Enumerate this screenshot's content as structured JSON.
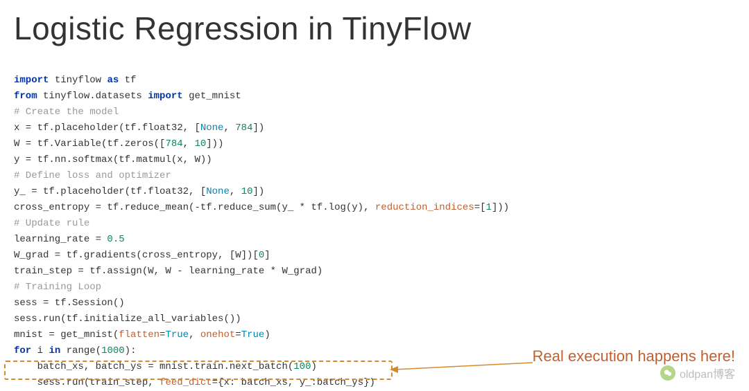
{
  "title": "Logistic Regression in TinyFlow",
  "code": {
    "l1": {
      "kw_import": "import",
      "mod": " tinyflow ",
      "kw_as": "as",
      "alias": " tf"
    },
    "l2": {
      "kw_from": "from",
      "mod": " tinyflow.datasets ",
      "kw_import": "import",
      "name": " get_mnist"
    },
    "l3": "# Create the model",
    "l4": {
      "pre": "x = tf.placeholder(tf.float32, [",
      "none": "None",
      "mid": ", ",
      "num": "784",
      "post": "])"
    },
    "l5": {
      "pre": "W = tf.Variable(tf.zeros([",
      "n1": "784",
      "mid": ", ",
      "n2": "10",
      "post": "]))"
    },
    "l6": "y = tf.nn.softmax(tf.matmul(x, W))",
    "l7": "# Define loss and optimizer",
    "l8": {
      "pre": "y_ = tf.placeholder(tf.float32, [",
      "none": "None",
      "mid": ", ",
      "num": "10",
      "post": "])"
    },
    "l9": {
      "pre": "cross_entropy = tf.reduce_mean(-tf.reduce_sum(y_ * tf.log(y), ",
      "param": "reduction_indices",
      "eq": "=[",
      "num": "1",
      "post": "]))"
    },
    "l10": "# Update rule",
    "l11": {
      "pre": "learning_rate = ",
      "num": "0.5"
    },
    "l12": {
      "pre": "W_grad = tf.gradients(cross_entropy, [W])[",
      "num": "0",
      "post": "]"
    },
    "l13": "train_step = tf.assign(W, W - learning_rate * W_grad)",
    "l14": "# Training Loop",
    "l15": "sess = tf.Session()",
    "l16": "sess.run(tf.initialize_all_variables())",
    "l17": {
      "pre": "mnist = get_mnist(",
      "p1": "flatten",
      "eq1": "=",
      "v1": "True",
      "sep": ", ",
      "p2": "onehot",
      "eq2": "=",
      "v2": "True",
      "post": ")"
    },
    "l18": {
      "kw_for": "for",
      "var": " i ",
      "kw_in": "in",
      "fn": " range(",
      "num": "1000",
      "post": "):"
    },
    "l19": {
      "pre": "    batch_xs, batch_ys = mnist.train.next_batch(",
      "num": "100",
      "post": ")"
    },
    "l20": {
      "pre": "    sess.run(train_step, ",
      "param": "feed_dict",
      "post": "={x: batch_xs, y_:batch_ys})"
    }
  },
  "annotation": "Real execution happens here!",
  "watermark": "oldpan博客"
}
